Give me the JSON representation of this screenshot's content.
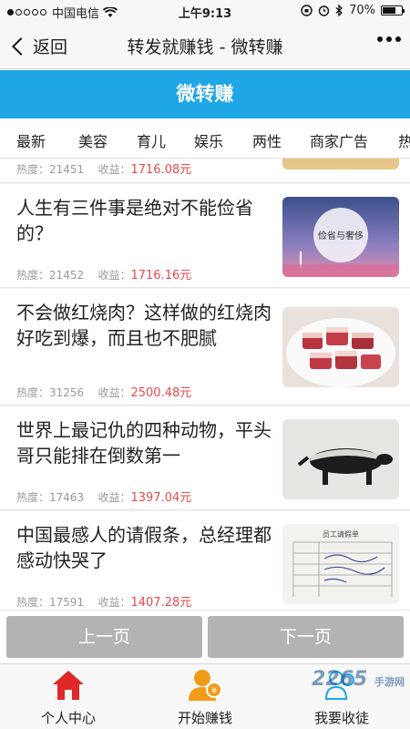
{
  "status": {
    "carrier": "中国电信",
    "time": "上午9:13",
    "battery": "70%",
    "battery_level": 0.7
  },
  "nav": {
    "back_label": "返回",
    "title": "转发就赚钱 - 微转赚"
  },
  "banner": {
    "title": "微转赚"
  },
  "tabs": [
    "最新",
    "美容",
    "育儿",
    "娱乐",
    "两性",
    "商家广告",
    "热"
  ],
  "partial": {
    "hot_label": "热度：",
    "hot": "21451",
    "income_label": "收益：",
    "income": "1716.08元"
  },
  "articles": [
    {
      "title": "人生有三件事是绝对不能俭省的？",
      "hot_label": "热度：",
      "hot": "21452",
      "income_label": "收益：",
      "income": "1716.16元",
      "thumb_text": "俭省与奢侈"
    },
    {
      "title": "不会做红烧肉？这样做的红烧肉好吃到爆，而且也不肥腻",
      "hot_label": "热度：",
      "hot": "31256",
      "income_label": "收益：",
      "income": "2500.48元"
    },
    {
      "title": "世界上最记仇的四种动物，平头哥只能排在倒数第一",
      "hot_label": "热度：",
      "hot": "17463",
      "income_label": "收益：",
      "income": "1397.04元"
    },
    {
      "title": "中国最感人的请假条，总经理都感动快哭了",
      "hot_label": "热度：",
      "hot": "17591",
      "income_label": "收益：",
      "income": "1407.28元",
      "thumb_text": "员工请假单"
    }
  ],
  "pager": {
    "prev": "上一页",
    "next": "下一页"
  },
  "tabbar": {
    "profile": "个人中心",
    "start": "开始赚钱",
    "income": "我要收徒"
  },
  "watermark": {
    "main": "2265",
    "sub": "手游网"
  },
  "colors": {
    "accent": "#1ea6e7",
    "income": "#e84a4a",
    "home_icon": "#e02828",
    "user_icon": "#f29b18"
  }
}
